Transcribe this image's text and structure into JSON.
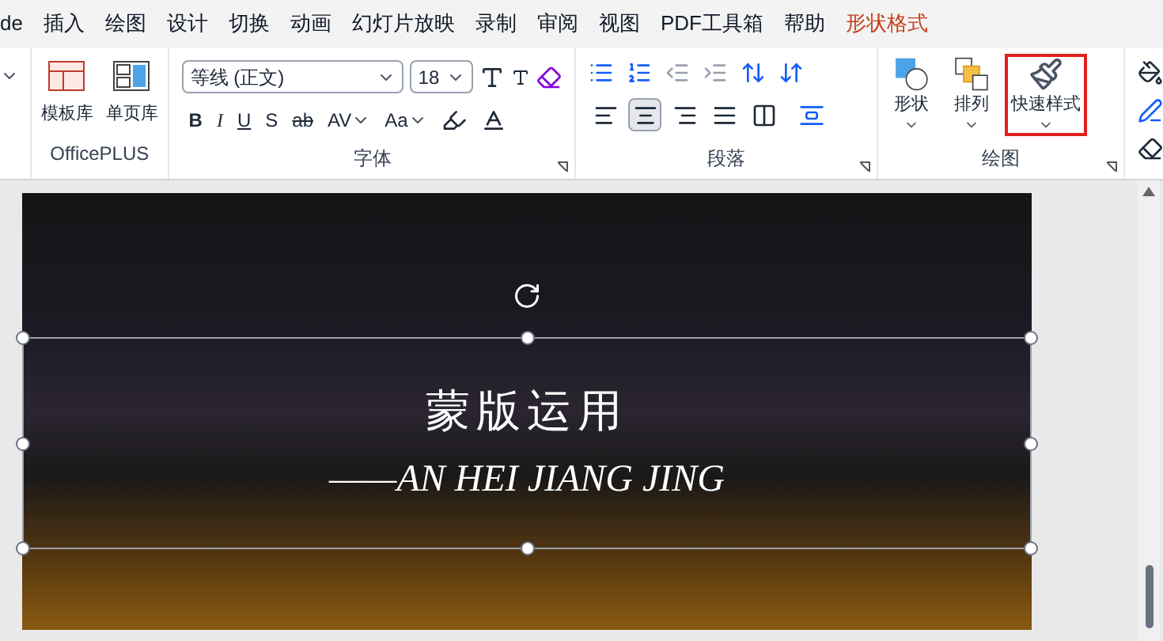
{
  "menu_tabs": [
    {
      "label": "de",
      "selected": false
    },
    {
      "label": "插入",
      "selected": false
    },
    {
      "label": "绘图",
      "selected": false
    },
    {
      "label": "设计",
      "selected": false
    },
    {
      "label": "切换",
      "selected": false
    },
    {
      "label": "动画",
      "selected": false
    },
    {
      "label": "幻灯片放映",
      "selected": false
    },
    {
      "label": "录制",
      "selected": false
    },
    {
      "label": "审阅",
      "selected": false
    },
    {
      "label": "视图",
      "selected": false
    },
    {
      "label": "PDF工具箱",
      "selected": false
    },
    {
      "label": "帮助",
      "selected": false
    },
    {
      "label": "形状格式",
      "selected": true
    }
  ],
  "ribbon": {
    "officeplus": {
      "label": "OfficePLUS",
      "buttons": [
        "模板库",
        "单页库"
      ]
    },
    "font": {
      "label": "字体",
      "font_name": "等线 (正文)",
      "font_size": "18",
      "buttons": [
        {
          "label": "B",
          "kind": "bold"
        },
        {
          "label": "I",
          "kind": "italic"
        },
        {
          "label": "U",
          "kind": "underline"
        },
        {
          "label": "S",
          "kind": "plain"
        },
        {
          "label": "ab",
          "kind": "strike"
        },
        {
          "label": "AV",
          "kind": "dropdown"
        },
        {
          "label": "Aa",
          "kind": "dropdown"
        }
      ]
    },
    "paragraph": {
      "label": "段落",
      "align_buttons": [
        {
          "selected": false
        },
        {
          "selected": true
        },
        {
          "selected": false
        },
        {
          "selected": false
        },
        {
          "selected": false
        }
      ]
    },
    "drawing": {
      "label": "绘图",
      "buttons": [
        {
          "label": "形状",
          "highlighted": false
        },
        {
          "label": "排列",
          "highlighted": false
        },
        {
          "label": "快速样式",
          "highlighted": true
        }
      ]
    }
  },
  "slide": {
    "title": "蒙版运用",
    "subtitle": "——AN HEI JIANG JING",
    "selected": true
  }
}
